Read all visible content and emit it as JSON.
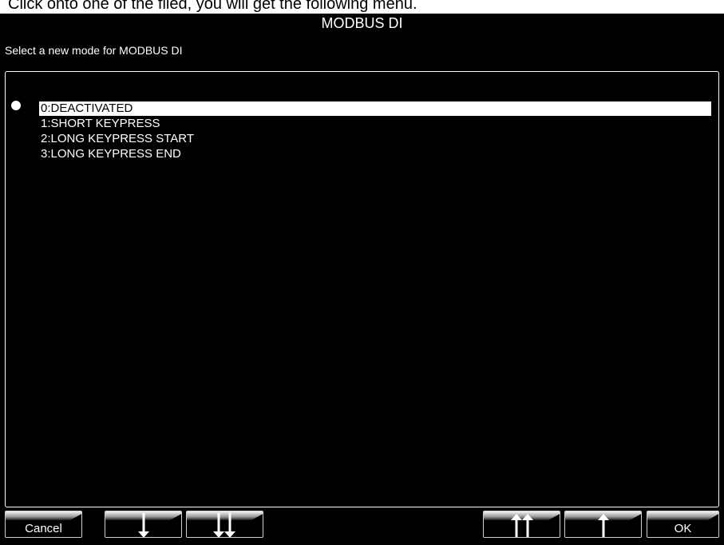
{
  "caption": "Click onto one of the filed, you will get the following menu.",
  "dialog": {
    "title": "MODBUS DI",
    "prompt": "Select a new mode for MODBUS DI"
  },
  "options": [
    {
      "label": "0:DEACTIVATED",
      "selected": true
    },
    {
      "label": "1:SHORT KEYPRESS",
      "selected": false
    },
    {
      "label": "2:LONG KEYPRESS START",
      "selected": false
    },
    {
      "label": "3:LONG KEYPRESS END",
      "selected": false
    }
  ],
  "buttons": {
    "cancel": "Cancel",
    "ok": "OK",
    "icons": [
      "arrow-down-icon",
      "double-arrow-down-icon",
      "double-arrow-up-icon",
      "arrow-up-icon"
    ]
  },
  "colors": {
    "screen": "#000000",
    "text": "#ffffff",
    "selection": "#ffffff"
  }
}
